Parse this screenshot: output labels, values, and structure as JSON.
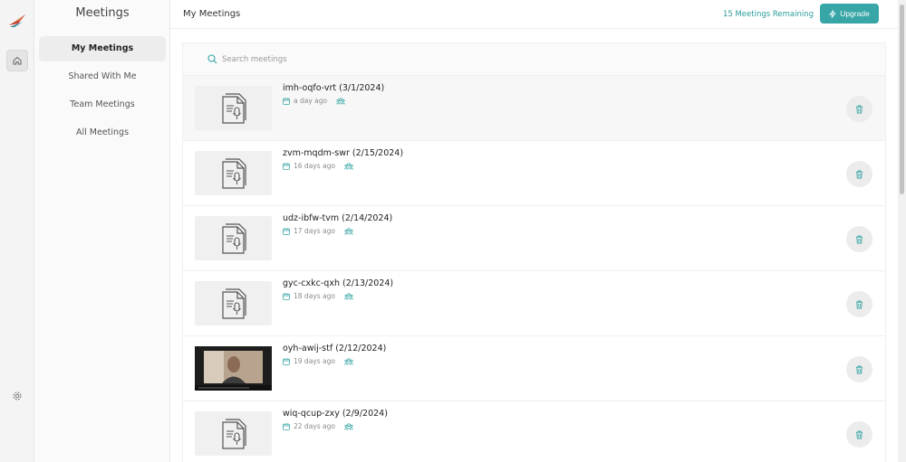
{
  "nav": {
    "title": "Meetings",
    "items": [
      {
        "label": "My Meetings"
      },
      {
        "label": "Shared With Me"
      },
      {
        "label": "Team Meetings"
      },
      {
        "label": "All Meetings"
      }
    ]
  },
  "header": {
    "title": "My Meetings",
    "remaining": "15 Meetings Remaining",
    "upgrade_label": "Upgrade"
  },
  "search": {
    "placeholder": "Search meetings"
  },
  "meetings": [
    {
      "title": "imh-oqfo-vrt (3/1/2024)",
      "ago": "a day ago",
      "thumbnail": "document-mic-icon"
    },
    {
      "title": "zvm-mqdm-swr (2/15/2024)",
      "ago": "16 days ago",
      "thumbnail": "document-mic-icon"
    },
    {
      "title": "udz-ibfw-tvm (2/14/2024)",
      "ago": "17 days ago",
      "thumbnail": "document-mic-icon"
    },
    {
      "title": "gyc-cxkc-qxh (2/13/2024)",
      "ago": "18 days ago",
      "thumbnail": "document-mic-icon"
    },
    {
      "title": "oyh-awij-stf (2/12/2024)",
      "ago": "19 days ago",
      "thumbnail": "video-frame"
    },
    {
      "title": "wiq-qcup-zxy (2/9/2024)",
      "ago": "22 days ago",
      "thumbnail": "document-mic-icon"
    }
  ],
  "colors": {
    "accent": "#38a6a6",
    "accent_text": "#2a9d9c"
  }
}
